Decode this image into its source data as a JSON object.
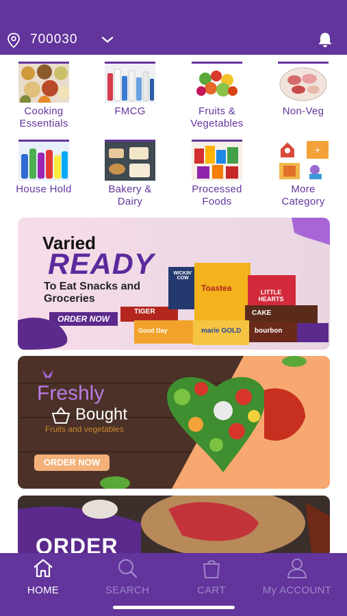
{
  "header": {
    "pincode": "700030"
  },
  "categories": [
    {
      "label_line1": "Cooking",
      "label_line2": "Essentials"
    },
    {
      "label_line1": "FMCG",
      "label_line2": ""
    },
    {
      "label_line1": "Fruits &",
      "label_line2": "Vegetables"
    },
    {
      "label_line1": "Non-Veg",
      "label_line2": ""
    },
    {
      "label_line1": "House Hold",
      "label_line2": ""
    },
    {
      "label_line1": "Bakery &",
      "label_line2": "Dairy"
    },
    {
      "label_line1": "Processed",
      "label_line2": "Foods"
    },
    {
      "label_line1": "More",
      "label_line2": "Category"
    }
  ],
  "banners": {
    "snacks": {
      "line1": "Varied",
      "line2": "READY",
      "line3": "To Eat Snacks and",
      "line4": "Groceries",
      "cta": "ORDER NOW",
      "packs": [
        "TIGER",
        "Toastea",
        "LITTLE HEARTS",
        "marie GOLD",
        "Good Day",
        "bourbon",
        "CAKE",
        "WICKIN' COW"
      ]
    },
    "fresh": {
      "title": "Freshly",
      "subtitle": "Bought",
      "tagline": "Fruits and vegetables",
      "cta": "ORDER NOW"
    },
    "meat": {
      "title": "ORDER"
    }
  },
  "tabbar": {
    "tabs": [
      {
        "label": "HOME",
        "icon": "home-icon"
      },
      {
        "label": "SEARCH",
        "icon": "search-icon"
      },
      {
        "label": "CART",
        "icon": "bag-icon"
      },
      {
        "label": "My ACCOUNT",
        "icon": "user-icon"
      }
    ]
  },
  "colors": {
    "brand_purple": "#62349c",
    "tab_inactive": "#9f86c9",
    "cta_orange": "#f3b179"
  }
}
